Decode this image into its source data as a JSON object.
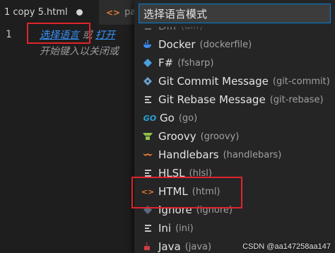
{
  "tabs": [
    {
      "label": "1 copy 5.html",
      "dirty": true
    },
    {
      "label": "pa"
    }
  ],
  "editor": {
    "line_number": "1",
    "hint": {
      "select_language": "选择语言",
      "or": "或",
      "open_partial": "打开",
      "line2": "开始键入以关闭或"
    }
  },
  "quickpick": {
    "value": "选择语言模式",
    "items": [
      {
        "label": "Diff",
        "id": "(diff)",
        "icon": "lines-icon"
      },
      {
        "label": "Docker",
        "id": "(dockerfile)",
        "icon": "docker-icon",
        "icon_color": "#3a8cf0"
      },
      {
        "label": "F#",
        "id": "(fsharp)",
        "icon": "fsharp-icon",
        "icon_color": "#49a0d8"
      },
      {
        "label": "Git Commit Message",
        "id": "(git-commit)",
        "icon": "git-icon",
        "icon_color": "#6aa0d0"
      },
      {
        "label": "Git Rebase Message",
        "id": "(git-rebase)",
        "icon": "lines-icon"
      },
      {
        "label": "Go",
        "id": "(go)",
        "icon": "go-icon",
        "icon_color": "#29a3d6"
      },
      {
        "label": "Groovy",
        "id": "(groovy)",
        "icon": "groovy-icon",
        "icon_color": "#8dc149"
      },
      {
        "label": "Handlebars",
        "id": "(handlebars)",
        "icon": "handlebars-icon",
        "icon_color": "#e37933"
      },
      {
        "label": "HLSL",
        "id": "(hlsl)",
        "icon": "lines-icon"
      },
      {
        "label": "HTML",
        "id": "(html)",
        "icon": "html-icon",
        "icon_color": "#e37933"
      },
      {
        "label": "Ignore",
        "id": "(ignore)",
        "icon": "ignore-icon",
        "icon_color": "#5a6a80"
      },
      {
        "label": "Ini",
        "id": "(ini)",
        "icon": "lines-icon"
      },
      {
        "label": "Java",
        "id": "(java)",
        "icon": "java-icon",
        "icon_color": "#cc3e44"
      }
    ]
  },
  "watermark": "CSDN @aa147258aa147",
  "colors": {
    "accent_focus": "#007fd4",
    "highlight_box": "#e0242b"
  }
}
